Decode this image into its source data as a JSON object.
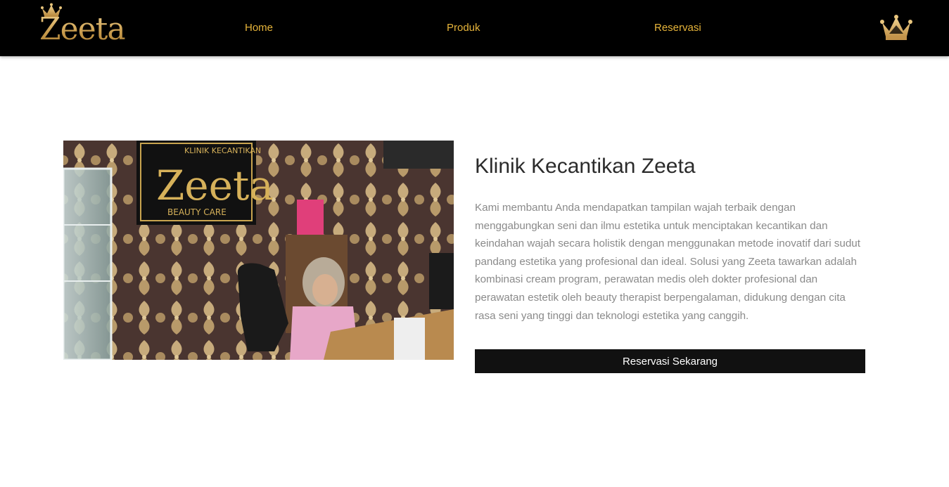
{
  "brand": {
    "name": "Zeeta",
    "logo_icon": "crown-icon",
    "gold": "#d9b26a",
    "nav_color": "#e6b43a"
  },
  "nav": {
    "items": [
      {
        "label": "Home"
      },
      {
        "label": "Produk"
      },
      {
        "label": "Reservasi"
      }
    ],
    "right_icon": "crown-icon"
  },
  "hero": {
    "photo": {
      "sign_line1": "KLINIK KECANTIKAN",
      "sign_brand": "Zeeta",
      "sign_line2": "BEAUTY CARE"
    },
    "title": "Klinik Kecantikan Zeeta",
    "description": "Kami membantu Anda mendapatkan tampilan wajah terbaik dengan menggabungkan seni dan ilmu estetika untuk menciptakan kecantikan dan keindahan wajah secara holistik dengan menggunakan metode inovatif dari sudut pandang estetika yang profesional dan ideal. Solusi yang Zeeta tawarkan adalah kombinasi cream program, perawatan medis oleh dokter profesional dan perawatan estetik oleh beauty therapist berpengalaman, didukung dengan cita rasa seni yang tinggi dan teknologi estetika yang canggih.",
    "cta_label": "Reservasi Sekarang"
  }
}
